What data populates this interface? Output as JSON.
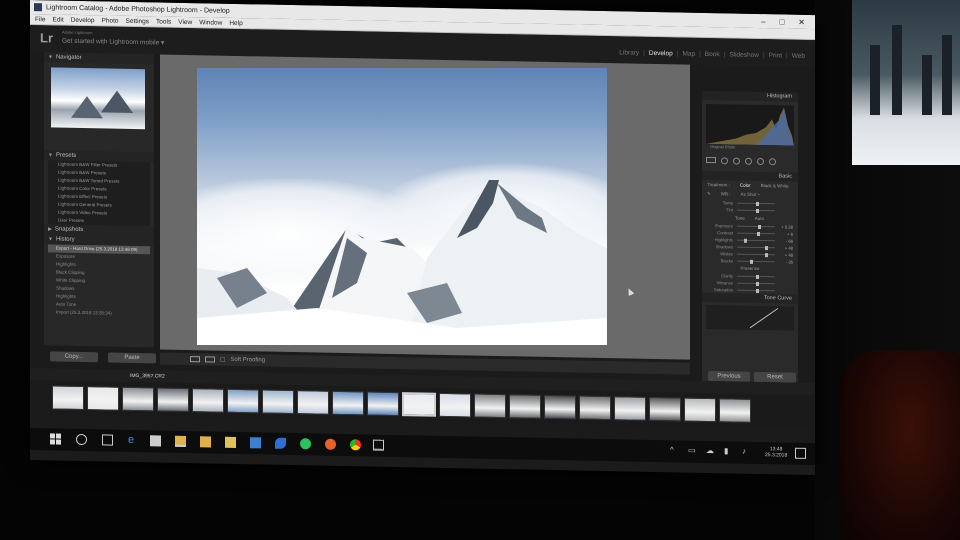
{
  "window": {
    "title": "Lightroom Catalog - Adobe Photoshop Lightroom - Develop",
    "controls": [
      "–",
      "□",
      "✕"
    ],
    "menu": [
      "File",
      "Edit",
      "Develop",
      "Photo",
      "Settings",
      "Tools",
      "View",
      "Window",
      "Help"
    ]
  },
  "lr_header": {
    "logo": "Lr",
    "identity_small": "Adobe Lightroom",
    "identity": "Get started with Lightroom mobile ▾",
    "modules": [
      "Library",
      "Develop",
      "Map",
      "Book",
      "Slideshow",
      "Print",
      "Web"
    ],
    "active_module": "Develop"
  },
  "left_panel": {
    "navigator_label": "Navigator",
    "presets_label": "Presets",
    "presets": [
      "Lightroom B&W Filter Presets",
      "Lightroom B&W Presets",
      "Lightroom B&W Toned Presets",
      "Lightroom Color Presets",
      "Lightroom Effect Presets",
      "Lightroom General Presets",
      "Lightroom Video Presets",
      "User Presets"
    ],
    "snapshots_label": "Snapshots",
    "history_label": "History",
    "history": [
      {
        "label": "Export - Hard Drive (25.3.2018 13:46:09)",
        "v1": "",
        "v2": ""
      },
      {
        "label": "Exposure",
        "v1": "",
        "v2": ""
      },
      {
        "label": "Highlights",
        "v1": "",
        "v2": ""
      },
      {
        "label": "Black Clipping",
        "v1": "",
        "v2": ""
      },
      {
        "label": "White Clipping",
        "v1": "",
        "v2": ""
      },
      {
        "label": "Shadows",
        "v1": "",
        "v2": ""
      },
      {
        "label": "Highlights",
        "v1": "",
        "v2": ""
      },
      {
        "label": "Auto Tone",
        "v1": "",
        "v2": ""
      },
      {
        "label": "Import (25.3.2018 13:35:34)",
        "v1": "",
        "v2": ""
      }
    ],
    "copy_label": "Copy...",
    "paste_label": "Paste"
  },
  "toolbar": {
    "soft_proofing": "Soft Proofing"
  },
  "right_panel": {
    "histogram_label": "Histogram",
    "original_photo": "Original Photo",
    "basic_label": "Basic",
    "treatment_label": "Treatment :",
    "color_label": "Color",
    "bw_label": "Black & White",
    "wb_label": "WB :",
    "wb_value": "As Shot ÷",
    "temp_label": "Temp",
    "tint_label": "Tint",
    "tone_label": "Tone",
    "auto_label": "Auto",
    "sliders": [
      {
        "label": "Exposure",
        "value": "+ 0.28",
        "pos": 0.55
      },
      {
        "label": "Contrast",
        "value": "+ 6",
        "pos": 0.53
      },
      {
        "label": "Highlights",
        "value": "- 66",
        "pos": 0.18
      },
      {
        "label": "Shadows",
        "value": "+ 48",
        "pos": 0.74
      },
      {
        "label": "Whites",
        "value": "+ 48",
        "pos": 0.74
      },
      {
        "label": "Blacks",
        "value": "- 35",
        "pos": 0.33
      }
    ],
    "presence_label": "Presence",
    "presence": [
      {
        "label": "Clarity",
        "value": "",
        "pos": 0.5
      },
      {
        "label": "Vibrance",
        "value": "",
        "pos": 0.5
      },
      {
        "label": "Saturation",
        "value": "",
        "pos": 0.5
      }
    ],
    "tone_curve_label": "Tone Curve",
    "previous_label": "Previous",
    "reset_label": "Reset"
  },
  "filmstrip": {
    "selected_file": "IMG_3957.CR2",
    "thumb_colors": [
      "#cfd3d8",
      "#e8e8e8",
      "#8a8f96",
      "#6a6f77",
      "#a9b1bb",
      "#7fa0c8",
      "#9fb6cf",
      "#c0ccda",
      "#6f95c3",
      "#5d86bc",
      "#e7ecf2",
      "#d6dde6",
      "#808487",
      "#6b6e70",
      "#4d5054",
      "#707174",
      "#9da1a5",
      "#585a5c",
      "#b6b9bc",
      "#8e9194"
    ],
    "selected_index": 10
  },
  "taskbar": {
    "time": "13:48",
    "date": "25.3.2018"
  }
}
